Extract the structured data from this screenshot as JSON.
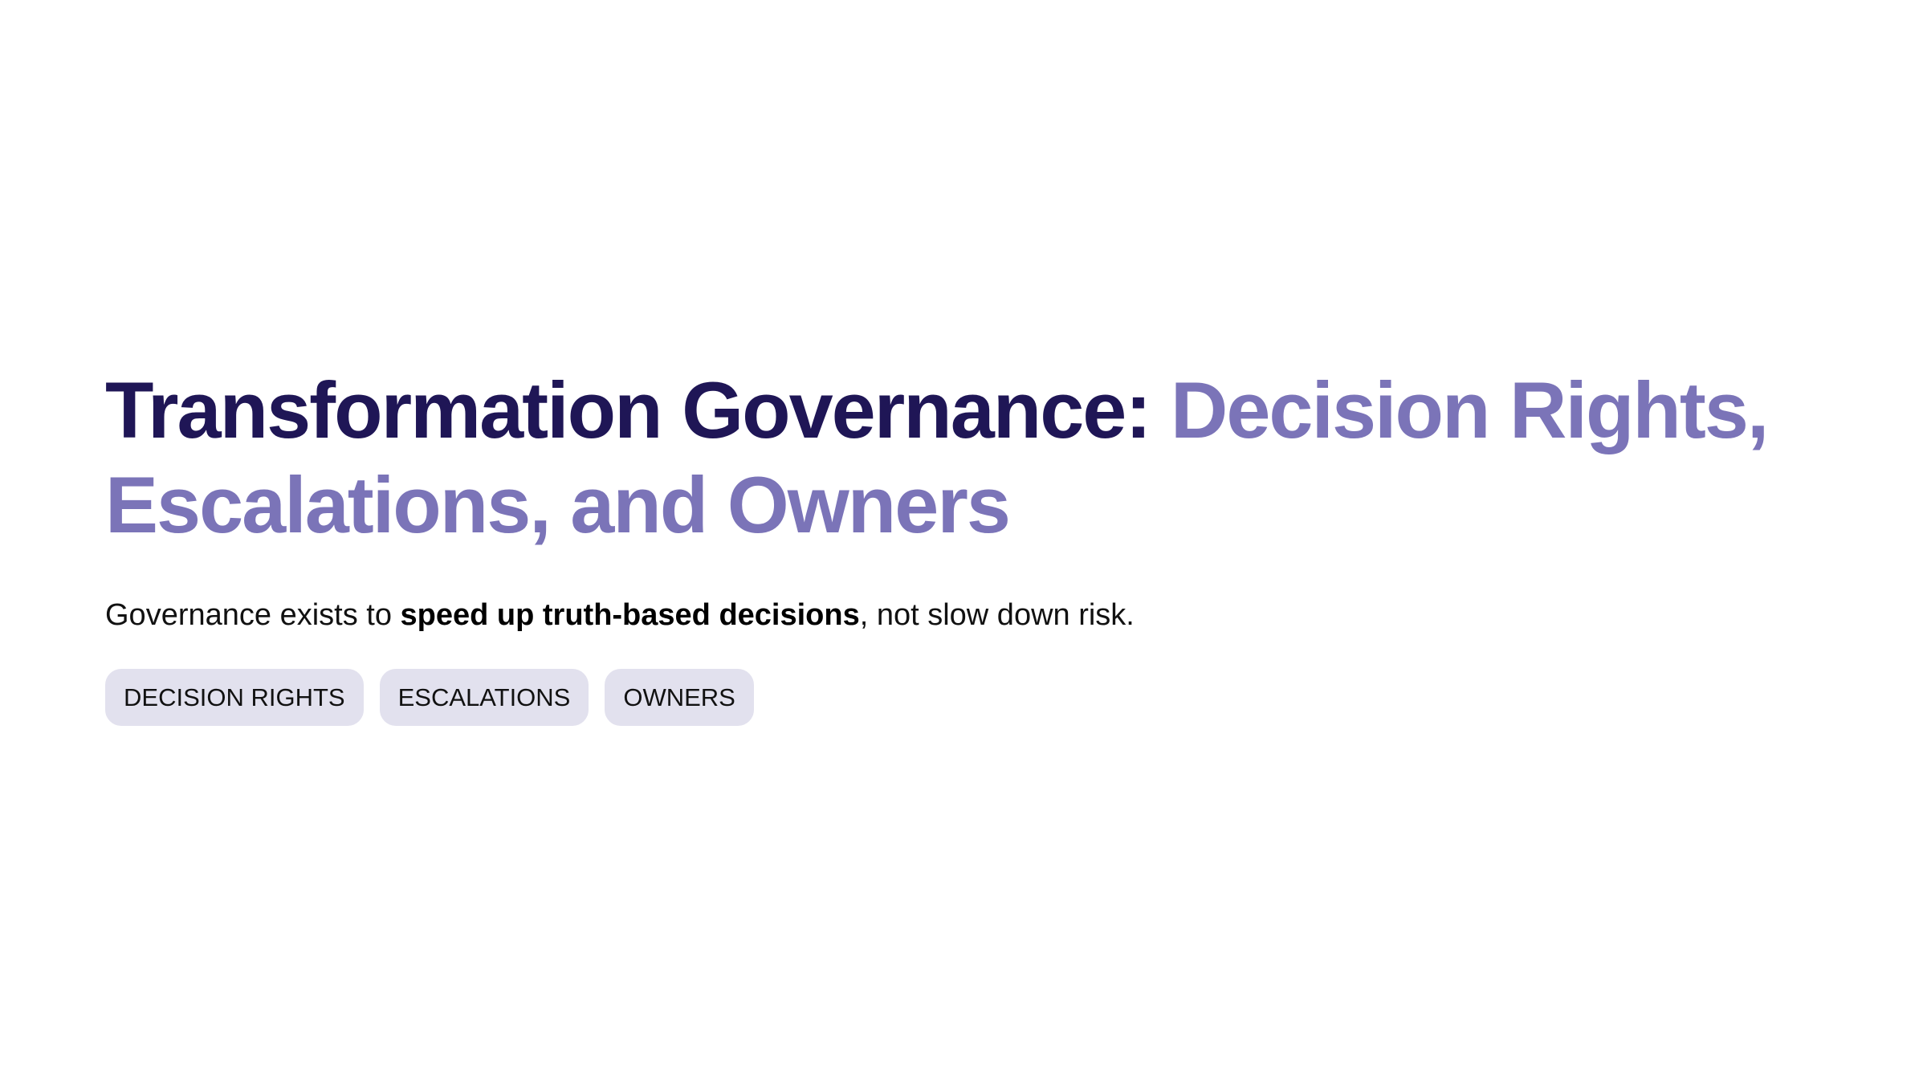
{
  "title": {
    "main": "Transformation Governance: ",
    "accent": "Decision Rights, Escalations, and Owners"
  },
  "subtitle": {
    "before": "Governance exists to ",
    "bold": "speed up truth-based decisions",
    "after": ", not slow down risk."
  },
  "tags": [
    "DECISION RIGHTS",
    "ESCALATIONS",
    "OWNERS"
  ],
  "colors": {
    "title_primary": "#1f1656",
    "title_accent": "#7b74b8",
    "tag_background": "#e2e1ee"
  }
}
